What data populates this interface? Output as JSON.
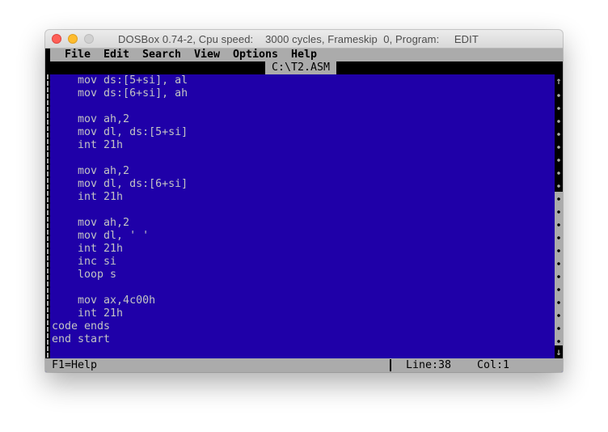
{
  "window": {
    "title": "DOSBox 0.74-2, Cpu speed:    3000 cycles, Frameskip  0, Program:     EDIT"
  },
  "menu": {
    "items": [
      {
        "label": "File"
      },
      {
        "label": "Edit"
      },
      {
        "label": "Search"
      },
      {
        "label": "View"
      },
      {
        "label": "Options"
      },
      {
        "label": "Help"
      }
    ]
  },
  "editor": {
    "filename": "C:\\T2.ASM",
    "lines": [
      "    mov ds:[5+si], al",
      "    mov ds:[6+si], ah",
      "",
      "    mov ah,2",
      "    mov dl, ds:[5+si]",
      "    int 21h",
      "",
      "    mov ah,2",
      "    mov dl, ds:[6+si]",
      "    int 21h",
      "",
      "    mov ah,2",
      "    mov dl, ' '",
      "    int 21h",
      "    inc si",
      "    loop s",
      "",
      "    mov ax,4c00h",
      "    int 21h",
      "code ends",
      "end start"
    ]
  },
  "scrollbar": {
    "up_arrow": "↑",
    "down_arrow": "↓"
  },
  "statusbar": {
    "help": "F1=Help",
    "line": "Line:38",
    "col": "Col:1"
  },
  "colors": {
    "editor_bg": "#1f00a8",
    "text": "#c4c4c4",
    "menu_bg": "#ababab"
  }
}
